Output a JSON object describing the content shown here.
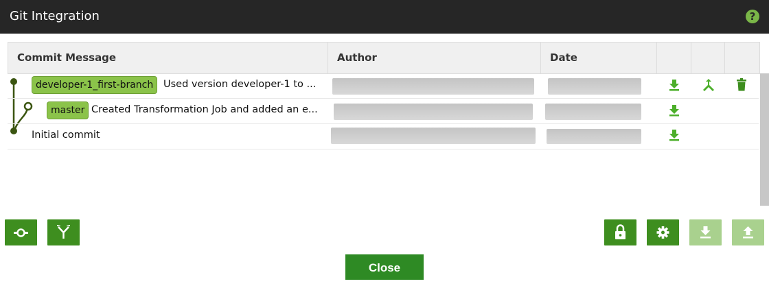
{
  "window": {
    "title": "Git Integration",
    "help_icon": "question-icon",
    "help_glyph": "?"
  },
  "table": {
    "columns": [
      "Commit Message",
      "Author",
      "Date",
      "",
      "",
      ""
    ],
    "rows": [
      {
        "branch_tag": "developer-1_first-branch",
        "message": "Used version developer-1 to ...",
        "author": "",
        "date": "",
        "actions": [
          "download-icon",
          "merge-icon",
          "delete-icon"
        ]
      },
      {
        "branch_tag": "master",
        "message": "Created Transformation Job and added an e...",
        "author": "",
        "date": "",
        "actions": [
          "download-icon"
        ]
      },
      {
        "branch_tag": "",
        "message": "Initial commit",
        "author": "",
        "date": "",
        "actions": [
          "download-icon"
        ]
      }
    ]
  },
  "toolbar": {
    "left_buttons": [
      "commit-icon",
      "branch-icon"
    ],
    "right_buttons": [
      "lock-icon",
      "gear-icon",
      "pull-icon",
      "push-icon"
    ],
    "disabled_buttons": [
      "pull-icon",
      "push-icon"
    ]
  },
  "footer": {
    "close_label": "Close"
  },
  "colors": {
    "accent": "#3e8e1f",
    "tag": "#8bc34a",
    "graph": "#3b5511",
    "titlebar": "#262626"
  }
}
